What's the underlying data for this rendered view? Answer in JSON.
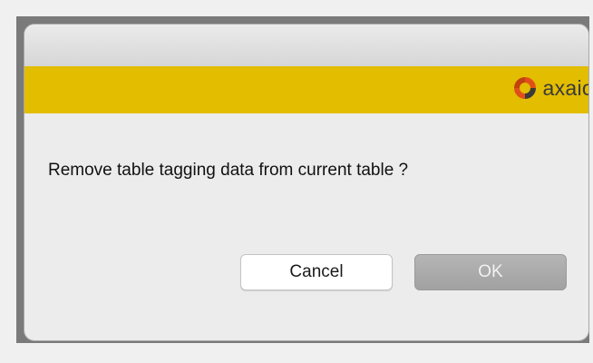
{
  "dialog": {
    "message": "Remove table tagging data from current table ?",
    "brand": {
      "name": "axaio",
      "icon": "axaio-logo-icon",
      "banner_color": "#e2bd00",
      "logo_color": "#e04f1a"
    },
    "buttons": {
      "cancel_label": "Cancel",
      "ok_label": "OK"
    }
  }
}
